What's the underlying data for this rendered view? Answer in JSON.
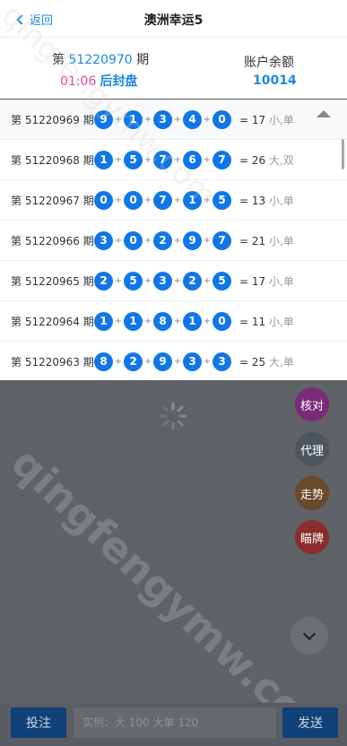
{
  "header": {
    "back_label": "返回",
    "title": "澳洲幸运5"
  },
  "current": {
    "period_prefix": "第",
    "period_number": "51220970",
    "period_suffix": "期",
    "countdown": "01:06",
    "status": "后封盘",
    "balance_label": "账户余额",
    "balance_value": "10014"
  },
  "results": [
    {
      "label": "第 51220969 期",
      "balls": [
        "9",
        "1",
        "3",
        "4",
        "0"
      ],
      "sum": "= 17",
      "tag": "小,单"
    },
    {
      "label": "第 51220968 期",
      "balls": [
        "1",
        "5",
        "7",
        "6",
        "7"
      ],
      "sum": "= 26",
      "tag": "大,双"
    },
    {
      "label": "第 51220967 期",
      "balls": [
        "0",
        "0",
        "7",
        "1",
        "5"
      ],
      "sum": "= 13",
      "tag": "小,单"
    },
    {
      "label": "第 51220966 期",
      "balls": [
        "3",
        "0",
        "2",
        "9",
        "7"
      ],
      "sum": "= 21",
      "tag": "小,单"
    },
    {
      "label": "第 51220965 期",
      "balls": [
        "2",
        "5",
        "3",
        "2",
        "5"
      ],
      "sum": "= 17",
      "tag": "小,单"
    },
    {
      "label": "第 51220964 期",
      "balls": [
        "1",
        "1",
        "8",
        "1",
        "0"
      ],
      "sum": "= 11",
      "tag": "小,单"
    },
    {
      "label": "第 51220963 期",
      "balls": [
        "8",
        "2",
        "9",
        "3",
        "3"
      ],
      "sum": "= 25",
      "tag": "大,单"
    }
  ],
  "fabs": {
    "verify": "核对",
    "agent": "代理",
    "trend": "走势",
    "peek": "瞄牌"
  },
  "bottom": {
    "bet_label": "投注",
    "input_placeholder": "实例：大 100 大单 120",
    "send_label": "发送"
  },
  "watermark": {
    "text": "qingfengymw.com"
  },
  "colors": {
    "accent": "#1e88e5",
    "ball": "#1177e8",
    "countdown": "#e84393",
    "overlay": "#5f6266"
  }
}
